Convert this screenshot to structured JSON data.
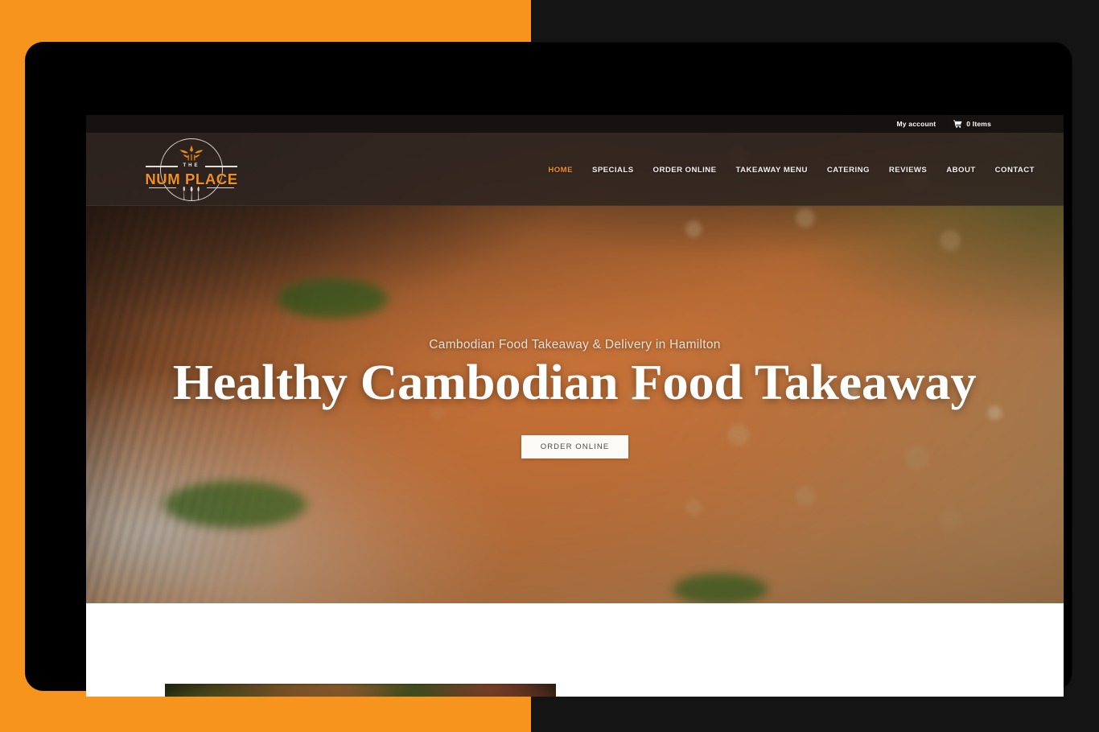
{
  "device": {
    "accent_orange": "#F7941E",
    "bezel_color": "#000000",
    "page_background": "#141414"
  },
  "site": {
    "topbar": {
      "account_label": "My account",
      "cart_icon": "shopping-cart-icon",
      "cart_label": "0 Items",
      "cart_count": 0
    },
    "logo": {
      "ornament_icon": "star-flower-ornament-icon",
      "the_text": "THE",
      "name_text": "NUM PLACE",
      "utensils_icon": "fork-knife-spoon-icon",
      "name_color": "#F0901F"
    },
    "nav": {
      "active_color": "#F0901F",
      "items": [
        {
          "label": "HOME",
          "active": true
        },
        {
          "label": "SPECIALS",
          "active": false
        },
        {
          "label": "ORDER ONLINE",
          "active": false
        },
        {
          "label": "TAKEAWAY MENU",
          "active": false
        },
        {
          "label": "CATERING",
          "active": false
        },
        {
          "label": "REVIEWS",
          "active": false
        },
        {
          "label": "ABOUT",
          "active": false
        },
        {
          "label": "CONTACT",
          "active": false
        }
      ]
    },
    "hero": {
      "subtitle": "Cambodian Food Takeaway & Delivery in Hamilton",
      "title": "Healthy Cambodian Food Takeaway",
      "cta_label": "ORDER ONLINE",
      "background_image_alt": "Close-up of Cambodian noodle salad with shredded carrot, bean sprouts, herbs and fried shallots"
    },
    "below_section": {
      "card_image_alt": "Food dish photo card"
    }
  }
}
